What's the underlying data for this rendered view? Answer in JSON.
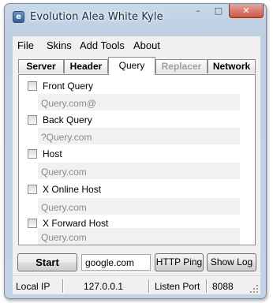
{
  "window": {
    "title": "Evolution Alea White Kyle",
    "icon": "app-icon",
    "controls": {
      "minimize": "–",
      "maximize": "□",
      "close": "✕"
    }
  },
  "menu": [
    {
      "label": "File"
    },
    {
      "label": "Skins"
    },
    {
      "label": "Add Tools"
    },
    {
      "label": "About"
    }
  ],
  "tabs": [
    {
      "label": "Server",
      "state": "normal"
    },
    {
      "label": "Header",
      "state": "normal"
    },
    {
      "label": "Query",
      "state": "active"
    },
    {
      "label": "Replacer",
      "state": "disabled"
    },
    {
      "label": "Network",
      "state": "normal"
    }
  ],
  "options": [
    {
      "label": "Front Query",
      "checked": false,
      "value": "Query.com@"
    },
    {
      "label": "Back Query",
      "checked": false,
      "value": "?Query.com"
    },
    {
      "label": "Host",
      "checked": false,
      "value": "Query.com"
    },
    {
      "label": "X Online Host",
      "checked": false,
      "value": "Query.com"
    },
    {
      "label": "X Forward Host",
      "checked": false,
      "value": "Query.com"
    }
  ],
  "actions": {
    "start_label": "Start",
    "host_value": "google.com",
    "ping_label": "HTTP Ping",
    "showlog_label": "Show Log"
  },
  "status": {
    "local_ip_label": "Local IP",
    "local_ip_value": "127.0.0.1",
    "listen_port_label": "Listen Port",
    "listen_port_value": "8088"
  }
}
